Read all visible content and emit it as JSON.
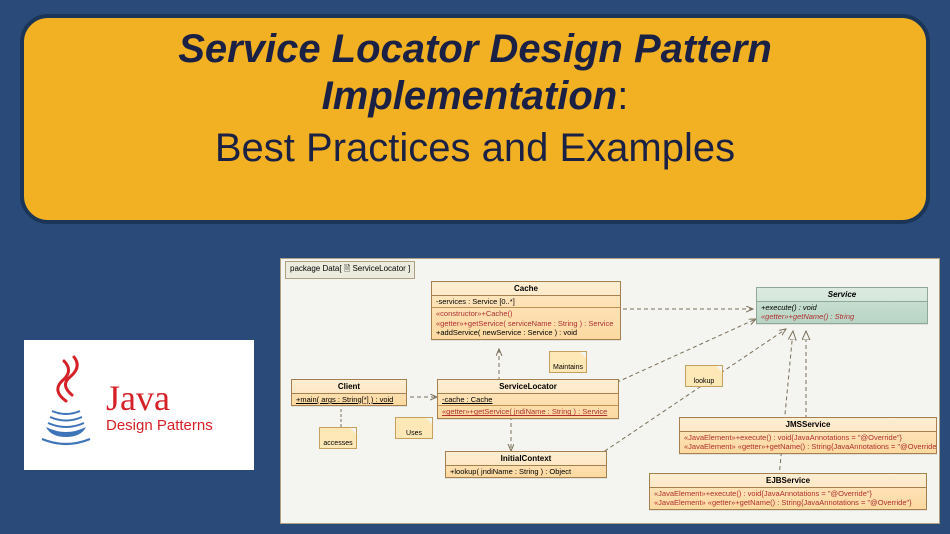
{
  "title": {
    "line1": "Service Locator Design Pattern",
    "line2": "Implementation",
    "colon": ":",
    "subtitle": "Best Practices and Examples"
  },
  "logo": {
    "brand": "Java",
    "subtitle": "Design Patterns"
  },
  "diagram": {
    "package_label": "package Data[ 🗎 ServiceLocator ]",
    "nodes": {
      "cache": {
        "name": "Cache",
        "attr": "-services : Service [0..*]",
        "op1": "«constructor»+Cache()",
        "op2": "«getter»+getService( serviceName : String ) : Service",
        "op3": "+addService( newService : Service ) : void"
      },
      "service": {
        "name": "Service",
        "op1": "+execute() : void",
        "op2": "«getter»+getName() : String"
      },
      "client": {
        "name": "Client",
        "op": "+main( args : String[*] ) : void"
      },
      "locator": {
        "name": "ServiceLocator",
        "attr": "-cache : Cache",
        "op": "«getter»+getService( jndiName : String ) : Service"
      },
      "initctx": {
        "name": "InitialContext",
        "op": "+lookup( jndiName : String ) : Object"
      },
      "jms": {
        "name": "JMSService",
        "op1": "«JavaElement»+execute() : void{JavaAnnotations = \"@Override\"}",
        "op2": "«JavaElement» «getter»+getName() : String{JavaAnnotations = \"@Override\"}"
      },
      "ejb": {
        "name": "EJBService",
        "op1": "«JavaElement»+execute() : void{JavaAnnotations = \"@Override\"}",
        "op2": "«JavaElement» «getter»+getName() : String{JavaAnnotations = \"@Override\"}"
      }
    },
    "notes": {
      "maintains": "Maintains",
      "accesses": "accesses",
      "uses": "Uses",
      "lookup": "lookup"
    }
  }
}
